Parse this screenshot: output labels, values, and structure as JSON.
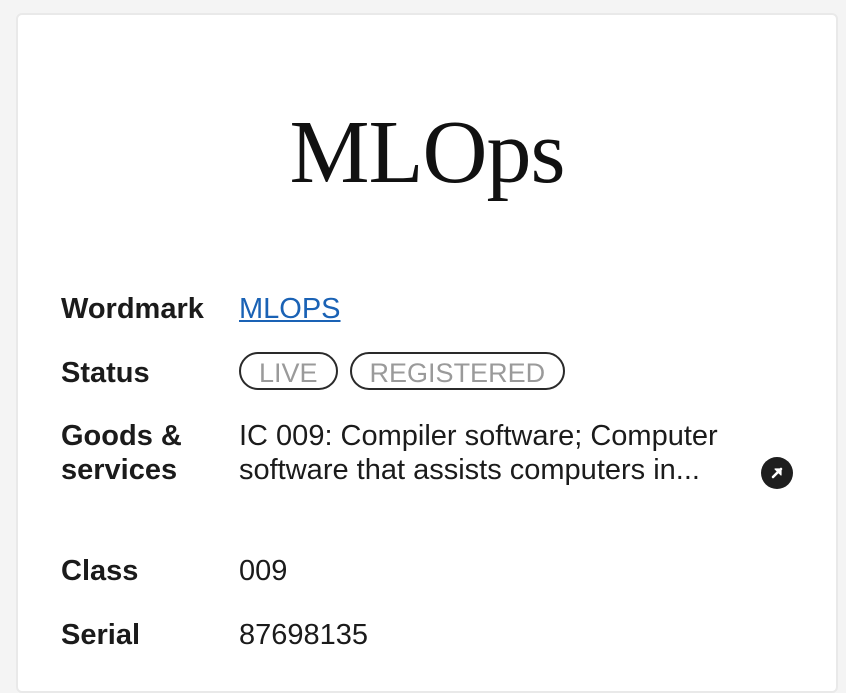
{
  "trademark": {
    "mark_text": "MLOps",
    "wordmark_label": "Wordmark",
    "wordmark_value": "MLOPS",
    "status_label": "Status",
    "status_badges": [
      "LIVE",
      "REGISTERED"
    ],
    "goods_label_line1": "Goods &",
    "goods_label_line2": "services",
    "goods_value": "IC 009: Compiler software; Computer software that assists computers in...",
    "class_label": "Class",
    "class_value": "009",
    "serial_label": "Serial",
    "serial_value": "87698135"
  },
  "colors": {
    "link": "#1a62b5",
    "badge_text": "#9a9a9a",
    "icon_bg": "#1e1e1e"
  },
  "icons": {
    "goods_expand": "arrow-up-right-icon"
  }
}
